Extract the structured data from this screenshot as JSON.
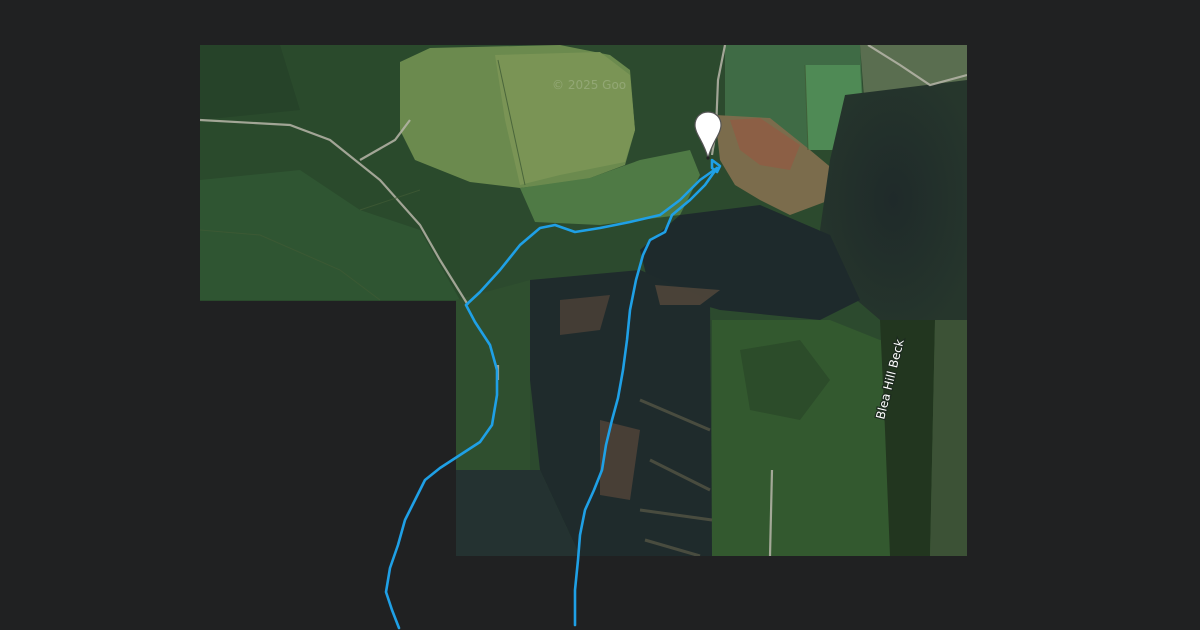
{
  "map": {
    "type": "satellite",
    "background_color": "#202122",
    "attribution_watermark": "© 2025 Goo",
    "labels": [
      {
        "text": "Blea Hill Beck",
        "kind": "stream"
      }
    ],
    "route": {
      "color": "#1fa0e6",
      "segments": 3
    },
    "marker": {
      "kind": "location-pin",
      "fill": "#ffffff",
      "stroke": "#555555"
    }
  }
}
